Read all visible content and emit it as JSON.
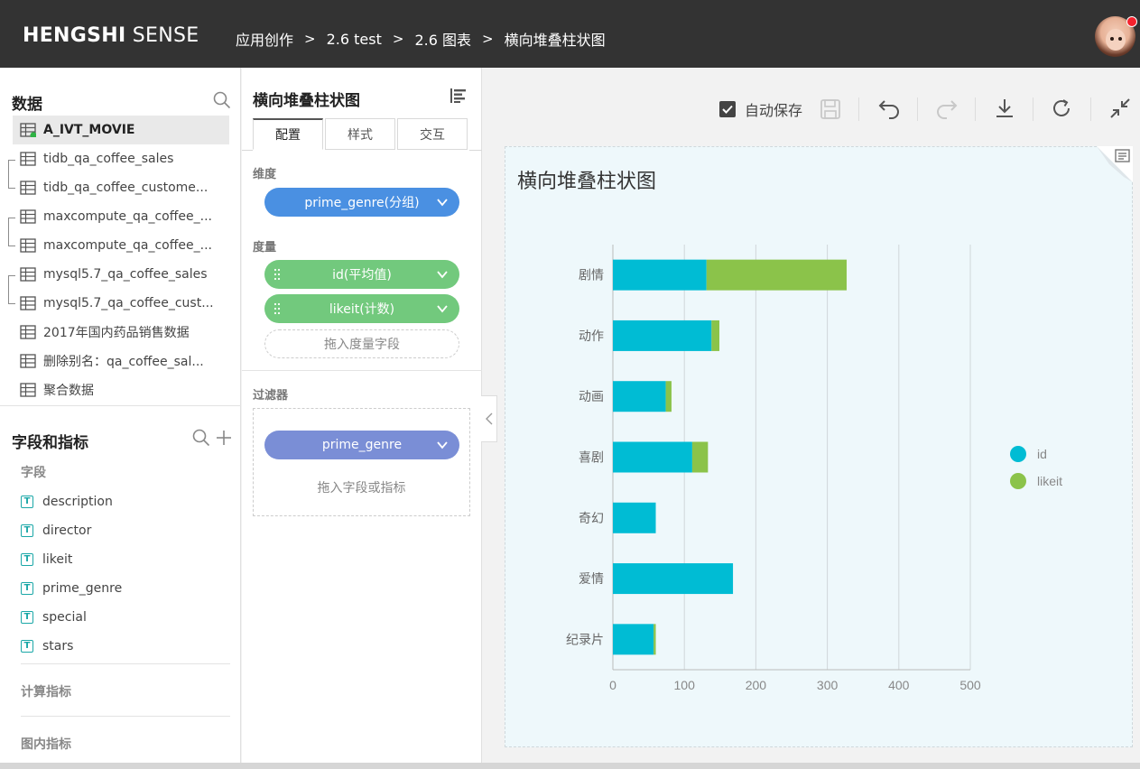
{
  "header": {
    "brand_bold": "HENGSHI",
    "brand_rest": " SENSE",
    "breadcrumb": [
      "应用创作",
      "2.6 test",
      "2.6 图表",
      "横向堆叠柱状图"
    ],
    "separator": ">"
  },
  "data_panel": {
    "title": "数据",
    "datasets": [
      {
        "label": "A_IVT_MOVIE",
        "active": true
      },
      {
        "label": "tidb_qa_coffee_sales"
      },
      {
        "label": "tidb_qa_coffee_custome..."
      },
      {
        "label": "maxcompute_qa_coffee_..."
      },
      {
        "label": "maxcompute_qa_coffee_..."
      },
      {
        "label": "mysql5.7_qa_coffee_sales"
      },
      {
        "label": "mysql5.7_qa_coffee_cust..."
      },
      {
        "label": "2017年国内药品销售数据"
      },
      {
        "label": "删除别名：qa_coffee_sal..."
      },
      {
        "label": "聚合数据"
      }
    ]
  },
  "fields_panel": {
    "title": "字段和指标",
    "fields_label": "字段",
    "fields": [
      "description",
      "director",
      "likeit",
      "prime_genre",
      "special",
      "stars"
    ],
    "field_type_icon": "T",
    "computed_label": "计算指标",
    "inchart_label": "图内指标"
  },
  "config_panel": {
    "title": "横向堆叠柱状图",
    "tabs": [
      "配置",
      "样式",
      "交互"
    ],
    "dimension_label": "维度",
    "dimension": "prime_genre(分组)",
    "measure_label": "度量",
    "measures": [
      "id(平均值)",
      "likeit(计数)"
    ],
    "measure_drop": "拖入度量字段",
    "filter_label": "过滤器",
    "filter": "prime_genre",
    "filter_drop": "拖入字段或指标"
  },
  "toolbar": {
    "autosave_label": "自动保存",
    "autosave_checked": true
  },
  "chart_data": {
    "type": "bar",
    "orientation": "horizontal",
    "stacked": true,
    "title": "横向堆叠柱状图",
    "categories": [
      "剧情",
      "动作",
      "动画",
      "喜剧",
      "奇幻",
      "爱情",
      "纪录片"
    ],
    "series": [
      {
        "name": "id",
        "color": "#00bcd4",
        "values": [
          131,
          138,
          74,
          111,
          60,
          168,
          57
        ]
      },
      {
        "name": "likeit",
        "color": "#8bc34a",
        "values": [
          196,
          11,
          8,
          22,
          0,
          0,
          3
        ]
      }
    ],
    "xlim": [
      0,
      500
    ],
    "xticks": [
      "0",
      "100",
      "200",
      "300",
      "400",
      "500"
    ],
    "grid": true,
    "legend_position": "right"
  }
}
